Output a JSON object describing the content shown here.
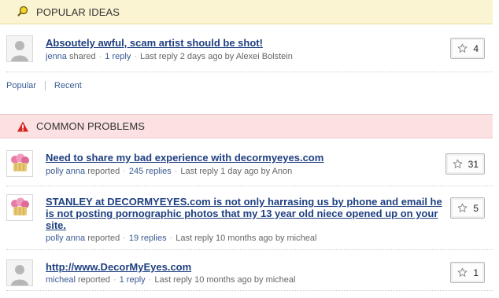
{
  "popular": {
    "header": "POPULAR IDEAS",
    "topics": [
      {
        "title": "Absoutely awful, scam artist should be shot!",
        "author": "jenna",
        "verb": "shared",
        "replies": "1 reply",
        "last_reply": "Last reply 2 days ago by Alexei Bolstein",
        "count": "4"
      }
    ],
    "tabs": {
      "popular": "Popular",
      "recent": "Recent"
    }
  },
  "problems": {
    "header": "COMMON PROBLEMS",
    "topics": [
      {
        "title": "Need to share my bad experience with decormyeyes.com",
        "author": "polly anna",
        "verb": "reported",
        "replies": "245 replies",
        "last_reply": "Last reply 1 day ago by Anon",
        "count": "31"
      },
      {
        "title": "STANLEY at DECORMYEYES.com is not only harrasing us by phone and email he is not posting pornographic photos that my 13 year old niece opened up on your site.",
        "author": "polly anna",
        "verb": "reported",
        "replies": "19 replies",
        "last_reply": "Last reply 10 months ago by micheal",
        "count": "5"
      },
      {
        "title": "http://www.DecorMyEyes.com",
        "author": "micheal",
        "verb": "reported",
        "replies": "1 reply",
        "last_reply": "Last reply 10 months ago by micheal",
        "count": "1"
      }
    ]
  }
}
